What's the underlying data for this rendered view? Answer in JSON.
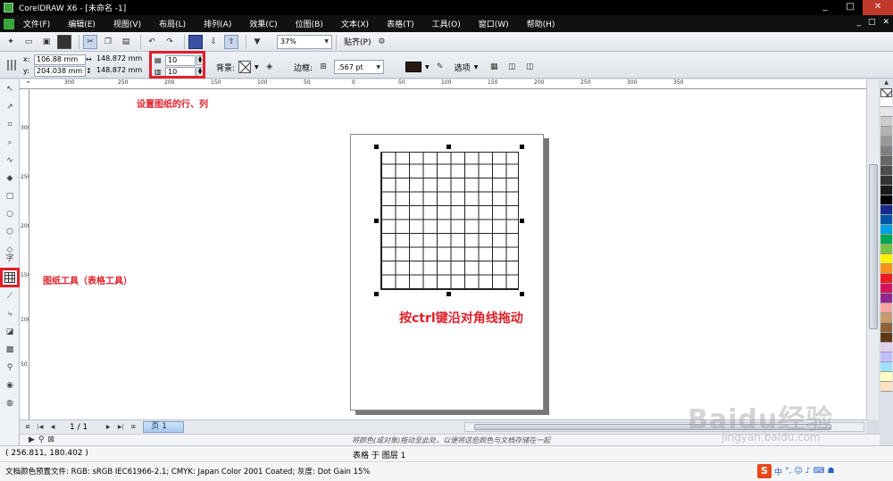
{
  "window": {
    "title": "CorelDRAW X6 - [未命名 -1]",
    "controls": [
      "_",
      "□",
      "✕"
    ]
  },
  "menu": {
    "items": [
      "文件(F)",
      "编辑(E)",
      "视图(V)",
      "布局(L)",
      "排列(A)",
      "效果(C)",
      "位图(B)",
      "文本(X)",
      "表格(T)",
      "工具(O)",
      "窗口(W)",
      "帮助(H)"
    ],
    "window_controls": [
      "_",
      "□",
      "✕"
    ]
  },
  "std_toolbar": {
    "zoom": "37%",
    "snap": "贴齐(P)"
  },
  "property_bar": {
    "x_label": "x:",
    "x_value": "106.88 mm",
    "y_label": "y:",
    "y_value": "204.038 mm",
    "width": "148.872 mm",
    "height": "148.872 mm",
    "rows": "10",
    "columns": "10",
    "background_label": "背景:",
    "border_label": "边框:",
    "border_width": ".567 pt",
    "options": "选项"
  },
  "ruler": {
    "top_labels": [
      "300",
      "250",
      "200",
      "150",
      "100",
      "50",
      "0",
      "50",
      "100",
      "150",
      "200",
      "250",
      "300",
      "350"
    ],
    "left_labels": [
      "300",
      "250",
      "200",
      "150",
      "100",
      "50"
    ]
  },
  "annotations": {
    "rows_cols": "设置图纸的行、列",
    "graph_tool": "图纸工具（表格工具）",
    "ctrl_drag": "按ctrl键沿对角线拖动"
  },
  "toolbox": {
    "text_tool": "字"
  },
  "page_nav": {
    "count": "1 / 1",
    "tab": "页 1"
  },
  "hint": "将颜色(或对象)拖动至此处，以便将这些颜色与文档存储在一起",
  "status": {
    "cursor": "( 256.811, 180.402 )",
    "selection": "表格 于 图层 1",
    "profile": "文档颜色预置文件: RGB: sRGB IEC61966-2.1; CMYK: Japan Color 2001 Coated; 灰度: Dot Gain 15%"
  },
  "ime": {
    "logo": "S",
    "lang": "中"
  },
  "watermark": {
    "main": "Baidu经验",
    "sub": "jingyan.baidu.com"
  },
  "palette": [
    "#ffffff",
    "#e6e6e6",
    "#cccccc",
    "#b3b3b3",
    "#999999",
    "#808080",
    "#666666",
    "#4d4d4d",
    "#333333",
    "#1a1a1a",
    "#000000",
    "#1a2a8c",
    "#0055a5",
    "#00a0e0",
    "#00a650",
    "#7cc242",
    "#fff200",
    "#f7941d",
    "#ed1c24",
    "#d4145a",
    "#92278f",
    "#f5a3a3",
    "#c69c6d",
    "#8c6239",
    "#603813",
    "#e0d0f0",
    "#c0c0ff",
    "#a0e0ff",
    "#ffffc0",
    "#ffe0c0"
  ]
}
